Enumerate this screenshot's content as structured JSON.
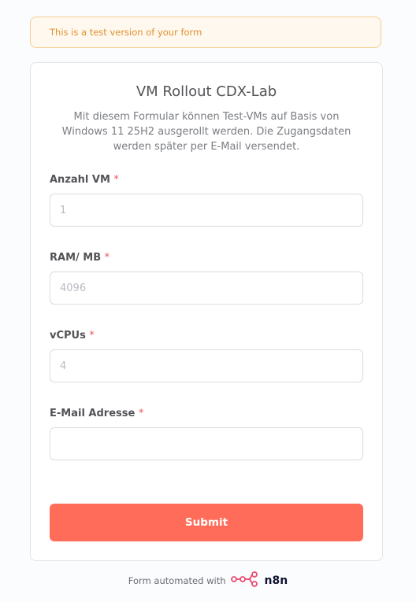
{
  "banner": {
    "text": "This is a test version of your form"
  },
  "form": {
    "title": "VM Rollout CDX-Lab",
    "description": "Mit diesem Formular können Test-VMs auf Basis von Windows 11 25H2 ausgerollt werden. Die Zugangsdaten werden später per E-Mail versendet.",
    "required_marker": "*",
    "fields": [
      {
        "label": "Anzahl VM",
        "value": "",
        "placeholder": "1"
      },
      {
        "label": "RAM/ MB",
        "value": "",
        "placeholder": "4096"
      },
      {
        "label": "vCPUs",
        "value": "",
        "placeholder": "4"
      },
      {
        "label": "E-Mail Adresse",
        "value": "",
        "placeholder": ""
      }
    ],
    "submit_label": "Submit"
  },
  "footer": {
    "text": "Form automated with",
    "brand": "n8n"
  },
  "colors": {
    "accent": "#ff6d5a",
    "required": "#e8575a",
    "banner_text": "#e0912f",
    "banner_bg": "#fff8ee",
    "banner_border": "#f4cf92"
  },
  "icons": {
    "footer_logo": "n8n-logo-icon"
  }
}
